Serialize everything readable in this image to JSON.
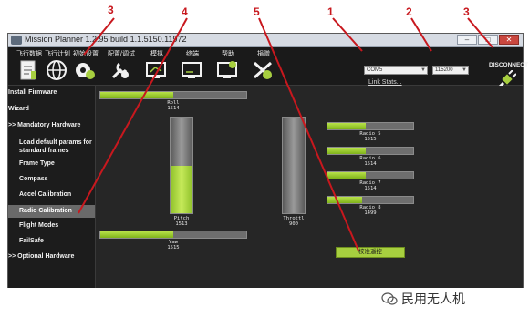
{
  "window": {
    "title": "Mission Planner 1.2.95 build 1.1.5150.11972",
    "minimize": "–",
    "maximize": "□",
    "close": "✕"
  },
  "toolbar": [
    {
      "label": "飞行数据",
      "icon": "flight-data-icon"
    },
    {
      "label": "飞行计划",
      "icon": "globe-icon"
    },
    {
      "label": "初始设置",
      "icon": "initial-setup-icon"
    },
    {
      "label": "配置/调试",
      "icon": "config-tuning-icon"
    },
    {
      "label": "模拟",
      "icon": "simulation-icon"
    },
    {
      "label": "终端",
      "icon": "terminal-icon"
    },
    {
      "label": "帮助",
      "icon": "help-icon"
    },
    {
      "label": "捐赠",
      "icon": "donate-icon"
    }
  ],
  "connection": {
    "port": "COM5",
    "baud": "115200",
    "link_stats": "Link Stats...",
    "disconnect": "DISCONNECT",
    "plug_icon": "plug-icon"
  },
  "sidebar": {
    "items": [
      {
        "label": "Install Firmware"
      },
      {
        "label": "Wizard"
      },
      {
        "label": ">> Mandatory Hardware"
      },
      {
        "label": "Load default params for standard frames"
      },
      {
        "label": "Frame Type"
      },
      {
        "label": "Compass"
      },
      {
        "label": "Accel Calibration"
      },
      {
        "label": "Radio Calibration"
      },
      {
        "label": "Flight Modes"
      },
      {
        "label": "FailSafe"
      },
      {
        "label": ">> Optional Hardware"
      }
    ],
    "selected": "Radio Calibration"
  },
  "radio": {
    "roll": {
      "name": "Roll",
      "value": "1514",
      "level": 0.5
    },
    "pitch": {
      "name": "Pitch",
      "value": "1513",
      "level": 0.5
    },
    "throttle": {
      "name": "Throttl",
      "value": "900",
      "level": 0.0
    },
    "yaw": {
      "name": "Yaw",
      "value": "1515",
      "level": 0.5
    },
    "radio5": {
      "name": "Radio 5",
      "value": "1515",
      "level": 0.45
    },
    "radio6": {
      "name": "Radio 6",
      "value": "1514",
      "level": 0.45
    },
    "radio7": {
      "name": "Radio 7",
      "value": "1514",
      "level": 0.45
    },
    "radio8": {
      "name": "Radio 8",
      "value": "1499",
      "level": 0.4
    }
  },
  "calibrate_button": "校准遥控",
  "annotations": {
    "colors": {
      "arrow": "#c8181e",
      "bar_fill": "#a7cf3f"
    },
    "numbers": [
      "1",
      "2",
      "3",
      "4",
      "5",
      "3"
    ]
  },
  "watermark": {
    "text": "民用无人机",
    "icon": "wechat-icon"
  }
}
